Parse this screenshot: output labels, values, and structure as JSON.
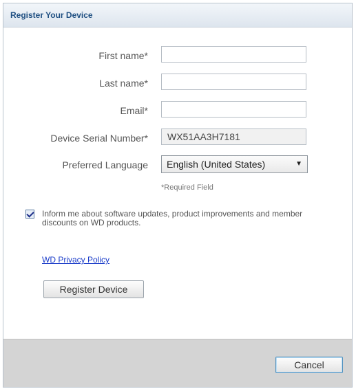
{
  "dialog": {
    "title": "Register Your Device"
  },
  "form": {
    "first_name_label": "First name*",
    "first_name_value": "",
    "last_name_label": "Last name*",
    "last_name_value": "",
    "email_label": "Email*",
    "email_value": "",
    "serial_label": "Device Serial Number*",
    "serial_value": "WX51AA3H7181",
    "language_label": "Preferred Language",
    "language_value": "English (United States)",
    "required_note": "*Required Field"
  },
  "options": {
    "inform_checked": true,
    "inform_text": "Inform me about software updates, product improvements and member discounts on WD products."
  },
  "links": {
    "privacy_label": "WD Privacy Policy"
  },
  "buttons": {
    "register_label": "Register Device",
    "cancel_label": "Cancel"
  },
  "icons": {
    "dropdown_arrow": "▼"
  }
}
